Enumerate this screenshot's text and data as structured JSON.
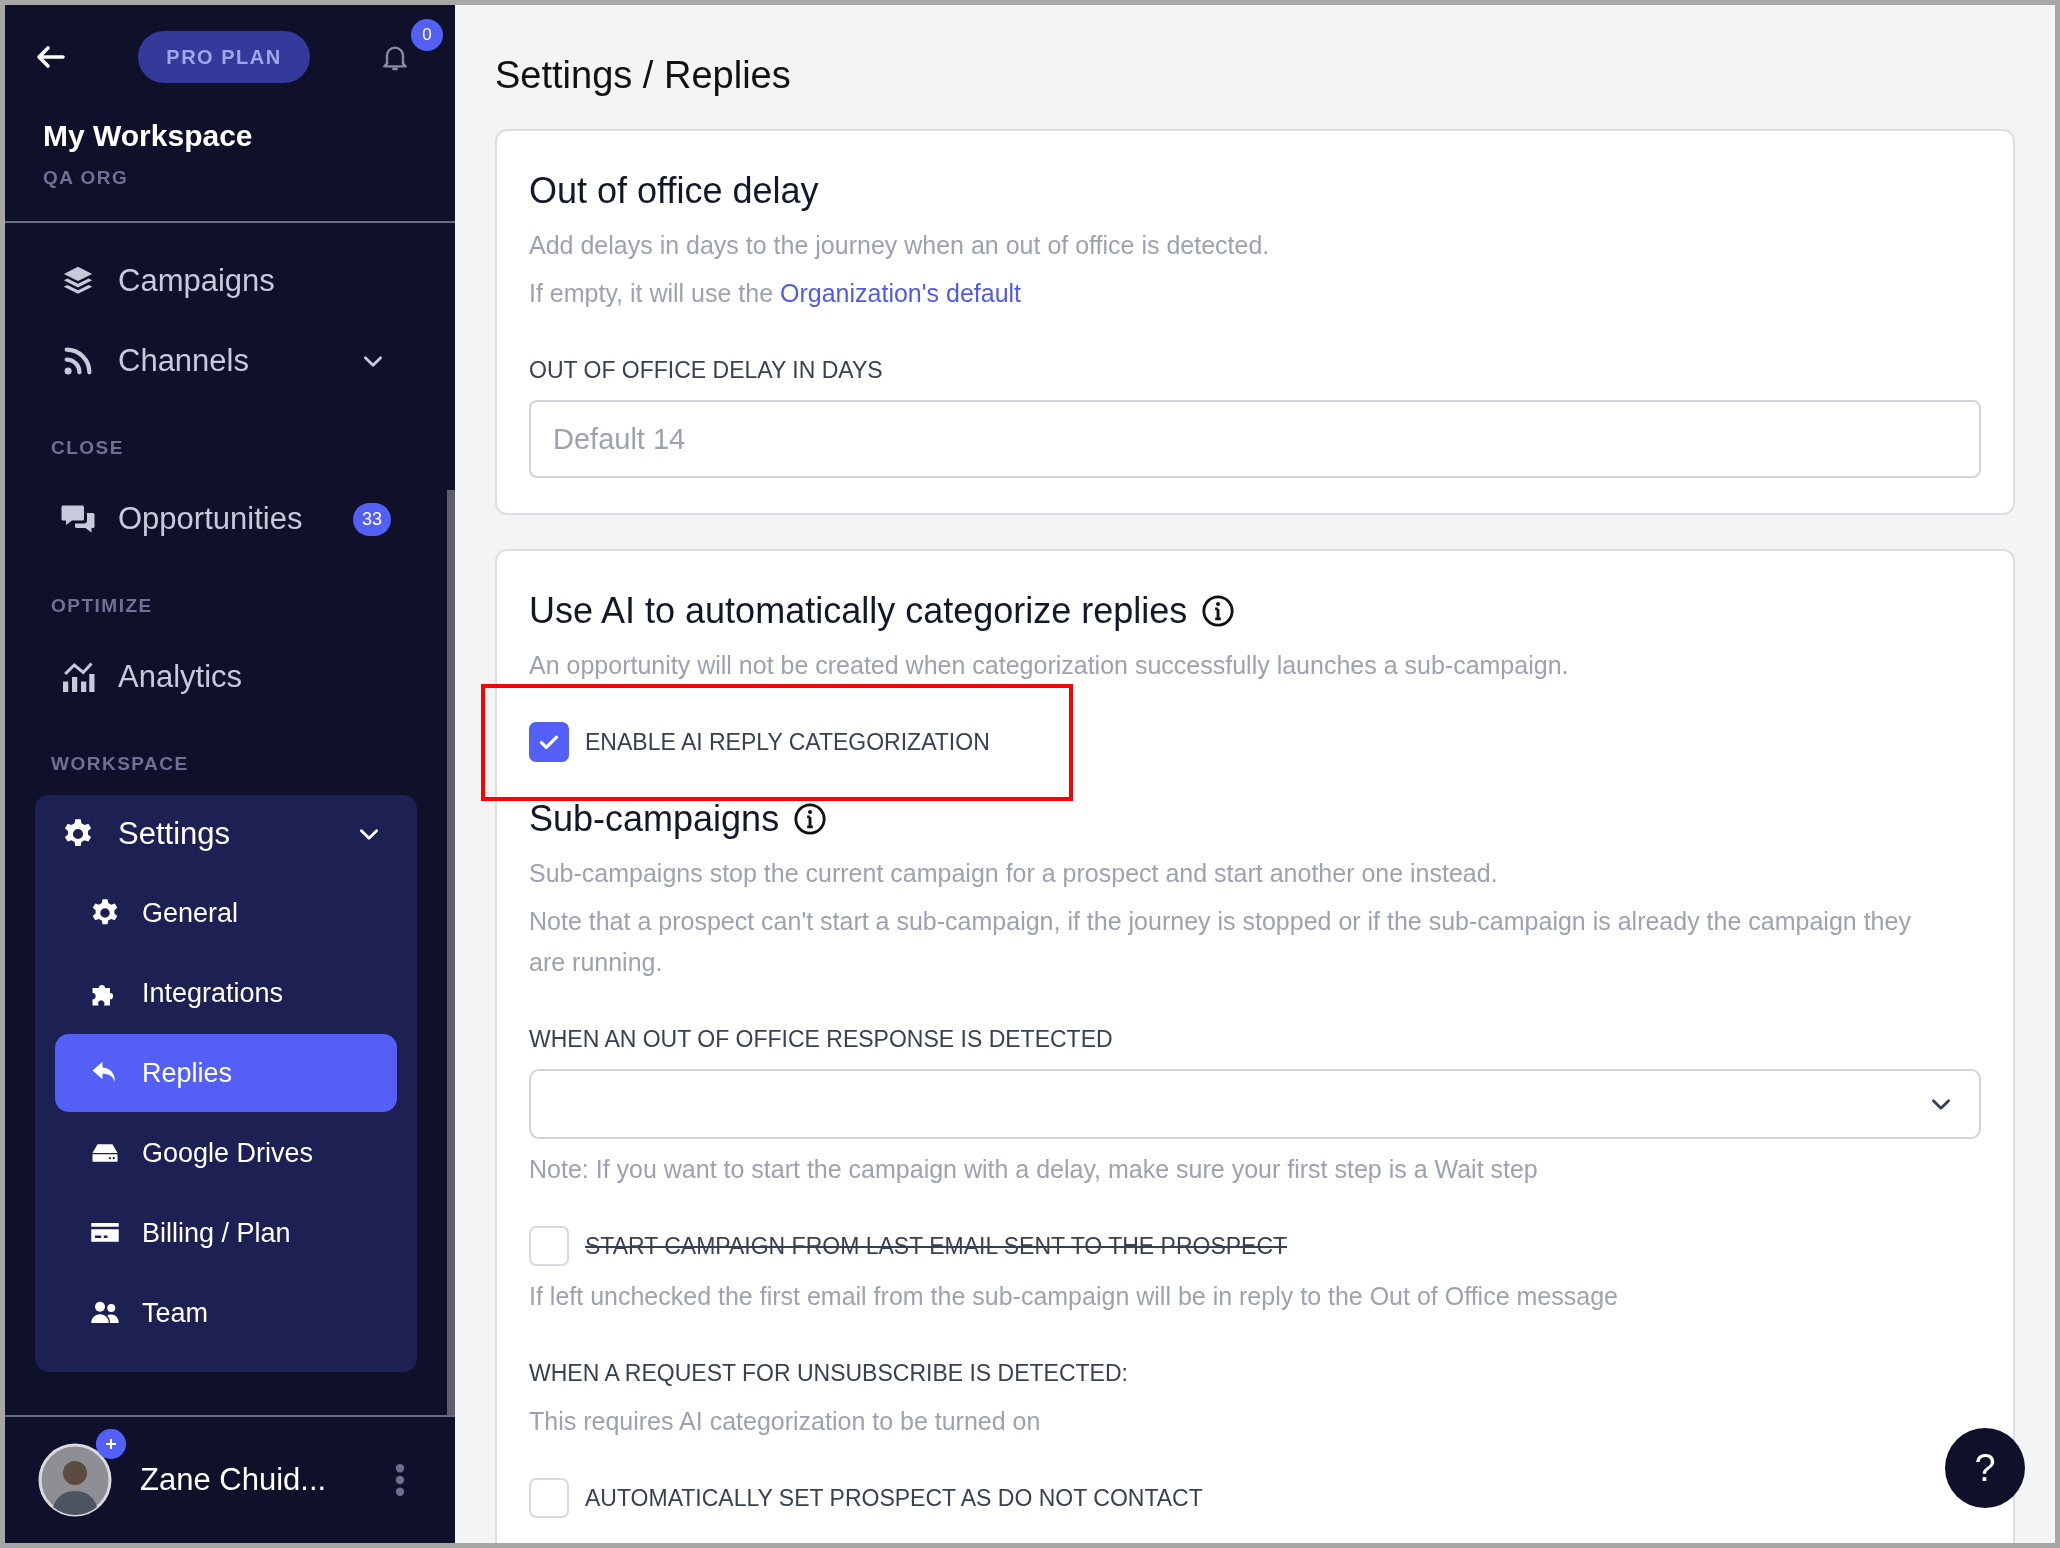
{
  "sidebar": {
    "plan": "PRO PLAN",
    "notification_count": "0",
    "workspace_name": "My Workspace",
    "org": "QA ORG",
    "sections": [
      {
        "items": [
          {
            "label": "Campaigns"
          },
          {
            "label": "Channels",
            "expanded": false
          }
        ]
      },
      {
        "heading": "CLOSE",
        "items": [
          {
            "label": "Opportunities",
            "badge": "33"
          }
        ]
      },
      {
        "heading": "OPTIMIZE",
        "items": [
          {
            "label": "Analytics"
          }
        ]
      },
      {
        "heading": "WORKSPACE",
        "items": [
          {
            "label": "Settings",
            "expanded": true,
            "children": [
              {
                "label": "General",
                "selected": false
              },
              {
                "label": "Integrations",
                "selected": false
              },
              {
                "label": "Replies",
                "selected": true
              },
              {
                "label": "Google Drives",
                "selected": false
              },
              {
                "label": "Billing / Plan",
                "selected": false
              },
              {
                "label": "Team",
                "selected": false
              }
            ]
          }
        ]
      }
    ],
    "user": {
      "name": "Zane Chuid..."
    }
  },
  "page_title": "Settings / Replies",
  "cards": [
    {
      "blocks": [
        {
          "kind": "heading",
          "text": "Out of office delay"
        },
        {
          "kind": "text",
          "text": "Add delays in days to the journey when an out of office is detected."
        },
        {
          "kind": "text",
          "text": "If empty, it will use the ",
          "link": "Organization's default"
        },
        {
          "kind": "label",
          "text": "OUT OF OFFICE DELAY IN DAYS"
        },
        {
          "kind": "input",
          "placeholder": "Default 14"
        }
      ]
    },
    {
      "blocks": [
        {
          "kind": "heading",
          "text": "Use AI to automatically categorize replies",
          "info": true
        },
        {
          "kind": "text",
          "text": "An opportunity will not be created when categorization successfully launches a sub-campaign."
        },
        {
          "kind": "checkbox",
          "label": "ENABLE AI REPLY CATEGORIZATION",
          "checked": true,
          "highlighted": true
        },
        {
          "kind": "heading",
          "text": "Sub-campaigns",
          "info": true
        },
        {
          "kind": "text",
          "text": "Sub-campaigns stop the current campaign for a prospect and start another one instead."
        },
        {
          "kind": "text",
          "text": "Note that a prospect can't start a sub-campaign, if the journey is stopped or if the sub-campaign is already the campaign they are running."
        },
        {
          "kind": "label",
          "text": "WHEN AN OUT OF OFFICE RESPONSE IS DETECTED"
        },
        {
          "kind": "select"
        },
        {
          "kind": "text",
          "text": "Note: If you want to start the campaign with a delay, make sure your first step is a Wait step"
        },
        {
          "kind": "checkbox",
          "label": "START CAMPAIGN FROM LAST EMAIL SENT TO THE PROSPECT",
          "checked": false,
          "struck": true
        },
        {
          "kind": "text",
          "text": "If left unchecked the first email from the sub-campaign will be in reply to the Out of Office message"
        },
        {
          "kind": "label",
          "text": "WHEN A REQUEST FOR UNSUBSCRIBE IS DETECTED:"
        },
        {
          "kind": "text",
          "text": "This requires AI categorization to be turned on"
        },
        {
          "kind": "checkbox",
          "label": "AUTOMATICALLY SET PROSPECT AS DO NOT CONTACT",
          "checked": false
        }
      ]
    }
  ],
  "help_button": "?"
}
